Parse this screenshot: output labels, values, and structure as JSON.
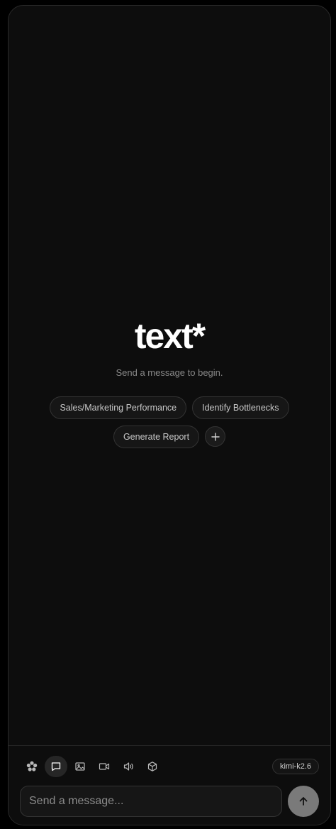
{
  "hero": {
    "logo": "text*",
    "subtitle": "Send a message to begin."
  },
  "suggestions": [
    "Sales/Marketing Performance",
    "Identify Bottlenecks",
    "Generate Report"
  ],
  "toolbar": {
    "tools": [
      "settings-icon",
      "chat-icon",
      "image-icon",
      "video-icon",
      "audio-icon",
      "3d-cube-icon"
    ],
    "active": "chat-icon"
  },
  "model": "kimi-k2.6",
  "composer": {
    "placeholder": "Send a message..."
  }
}
